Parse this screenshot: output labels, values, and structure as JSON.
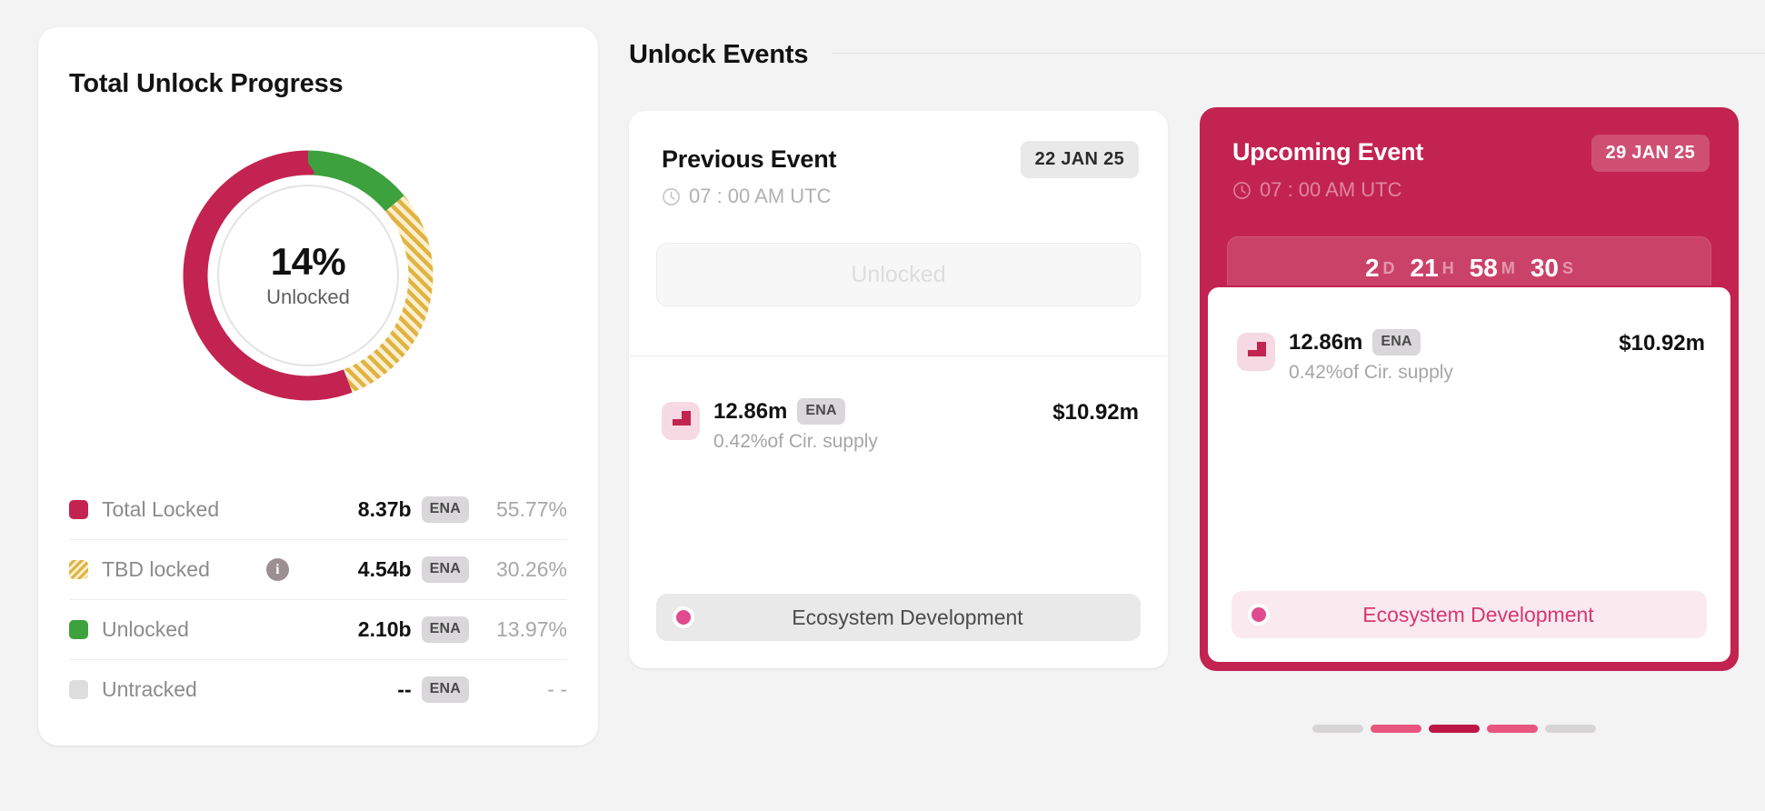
{
  "progress": {
    "title": "Total Unlock Progress",
    "donut": {
      "center_value": "14%",
      "center_label": "Unlocked"
    },
    "legend": [
      {
        "label": "Total Locked",
        "amount": "8.37b",
        "unit": "ENA",
        "percent": "55.77%",
        "color": "#c32350",
        "swatch": "solid",
        "info": false
      },
      {
        "label": "TBD locked",
        "amount": "4.54b",
        "unit": "ENA",
        "percent": "30.26%",
        "color": "#e0b341",
        "swatch": "hatch",
        "info": true,
        "info_glyph": "i"
      },
      {
        "label": "Unlocked",
        "amount": "2.10b",
        "unit": "ENA",
        "percent": "13.97%",
        "color": "#3da13d",
        "swatch": "solid",
        "info": false
      },
      {
        "label": "Untracked",
        "amount": "--",
        "unit": "ENA",
        "percent": "- -",
        "color": "#dddddd",
        "swatch": "solid",
        "info": false
      }
    ]
  },
  "events": {
    "section_title": "Unlock Events",
    "previous": {
      "title": "Previous Event",
      "date": "22 JAN 25",
      "time": "07 : 00 AM UTC",
      "status_button": "Unlocked",
      "amount": "12.86m",
      "unit": "ENA",
      "supply_note": "0.42%of Cir. supply",
      "usd_value": "$10.92m",
      "category": "Ecosystem Development",
      "category_dot_color": "#e04a8e"
    },
    "upcoming": {
      "title": "Upcoming Event",
      "date": "29 JAN 25",
      "time": "07 : 00 AM UTC",
      "countdown": {
        "days": "2",
        "days_unit": "D",
        "hours": "21",
        "hours_unit": "H",
        "minutes": "58",
        "minutes_unit": "M",
        "seconds": "30",
        "seconds_unit": "S"
      },
      "amount": "12.86m",
      "unit": "ENA",
      "supply_note": "0.42%of Cir. supply",
      "usd_value": "$10.92m",
      "category": "Ecosystem Development",
      "category_dot_color": "#e04a8e",
      "accent_color": "#c32350"
    },
    "pagination": [
      {
        "state": "inactive",
        "color": "#d7d4d6"
      },
      {
        "state": "near",
        "color": "#e8557f"
      },
      {
        "state": "active",
        "color": "#bd1747"
      },
      {
        "state": "near",
        "color": "#e8557f"
      },
      {
        "state": "inactive",
        "color": "#d7d4d6"
      }
    ]
  },
  "chart_data": {
    "type": "pie",
    "title": "Total Unlock Progress",
    "categories": [
      "Unlocked",
      "TBD locked",
      "Total Locked",
      "Untracked"
    ],
    "values": [
      13.97,
      30.26,
      55.77,
      0
    ],
    "amounts": [
      "2.10b",
      "4.54b",
      "8.37b",
      "--"
    ],
    "unit": "ENA",
    "colors": [
      "#3da13d",
      "#e0b341",
      "#c32350",
      "#dddddd"
    ],
    "center_label": "14% Unlocked",
    "donut": true,
    "start_angle_deg": 0,
    "direction": "clockwise",
    "legend_position": "below"
  }
}
